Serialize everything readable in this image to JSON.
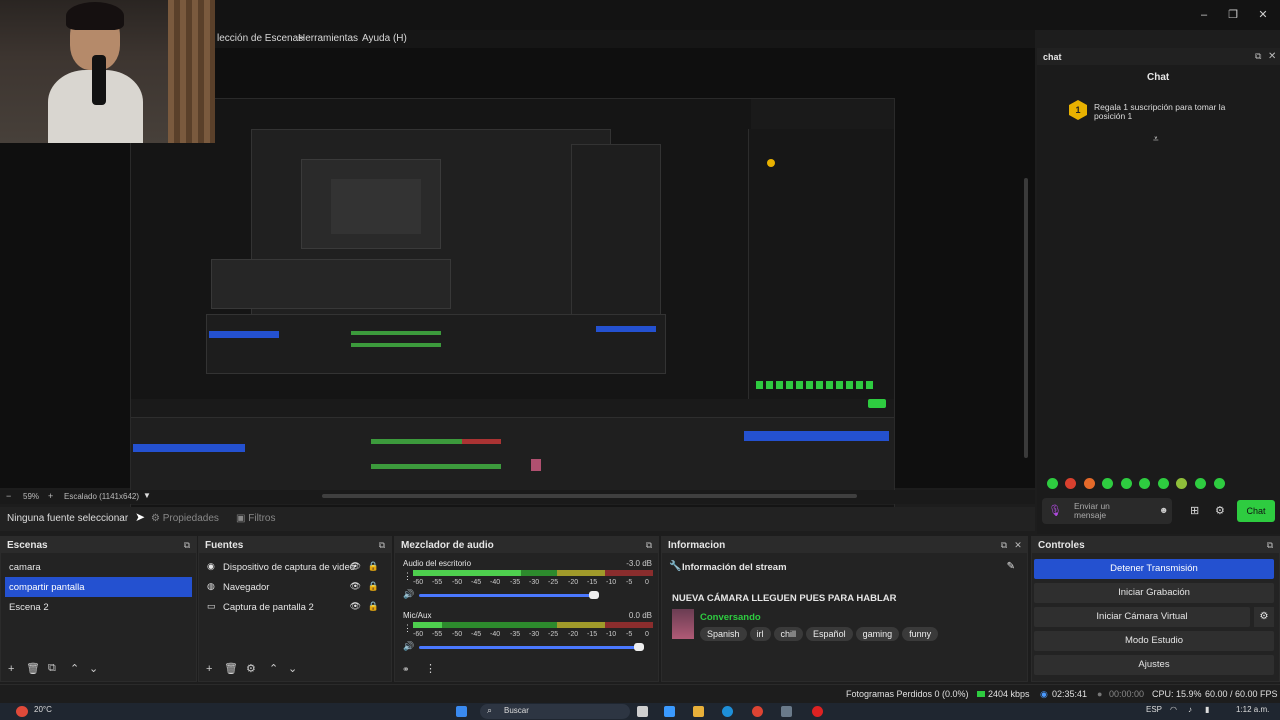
{
  "menu": {
    "items": [
      "lección de Escenas",
      "Herramientas",
      "Ayuda (H)"
    ]
  },
  "preview": {
    "zoom": "59%",
    "scale_label": "Escalado (1141x642)"
  },
  "source_bar": {
    "no_source": "Ninguna fuente seleccionar",
    "properties": "Propiedades",
    "filters": "Filtros"
  },
  "chat": {
    "dock_title": "chat",
    "header": "Chat",
    "notice": "Regala 1 suscripción para tomar la posición 1",
    "notice_rank": "1",
    "input_placeholder": "Enviar un mensaje",
    "send_label": "Chat"
  },
  "scenes": {
    "title": "Escenas",
    "items": [
      "camara",
      "compartir pantalla",
      "Escena 2"
    ],
    "selected": 1
  },
  "sources": {
    "title": "Fuentes",
    "items": [
      "Dispositivo de captura de video",
      "Navegador",
      "Captura de pantalla 2"
    ]
  },
  "mixer": {
    "title": "Mezclador de audio",
    "channels": [
      {
        "name": "Audio del escritorio",
        "db": "-3.0 dB",
        "level": 0.45,
        "volume": 0.8
      },
      {
        "name": "Mic/Aux",
        "db": "0.0 dB",
        "level": 0.12,
        "volume": 1.0
      }
    ],
    "ticks": [
      "-60",
      "-55",
      "-50",
      "-45",
      "-40",
      "-35",
      "-30",
      "-25",
      "-20",
      "-15",
      "-10",
      "-5",
      "0"
    ]
  },
  "info": {
    "title": "Informacion",
    "header": "Información del stream",
    "stream_title": "NUEVA CÁMARA LLEGUEN PUES PARA HABLAR",
    "category": "Conversando",
    "tags": [
      "Spanish",
      "irl",
      "chill",
      "Español",
      "gaming",
      "funny"
    ]
  },
  "controls": {
    "title": "Controles",
    "buttons": [
      "Detener Transmisión",
      "Iniciar Grabación",
      "Iniciar Cámara Virtual",
      "Modo Estudio",
      "Ajustes"
    ]
  },
  "status": {
    "dropped": "Fotogramas Perdidos 0 (0.0%)",
    "bitrate": "2404 kbps",
    "stream_time": "02:35:41",
    "rec_time": "00:00:00",
    "cpu": "CPU: 15.9%",
    "fps": "60.00 / 60.00 FPS"
  },
  "taskbar": {
    "weather": "20°C",
    "search": "Buscar",
    "lang": "ESP",
    "clock": "1:12 a.m."
  },
  "colors": {
    "accent": "#2451d0",
    "live_green": "#2ecc40",
    "twitch_green": "#00c853"
  }
}
